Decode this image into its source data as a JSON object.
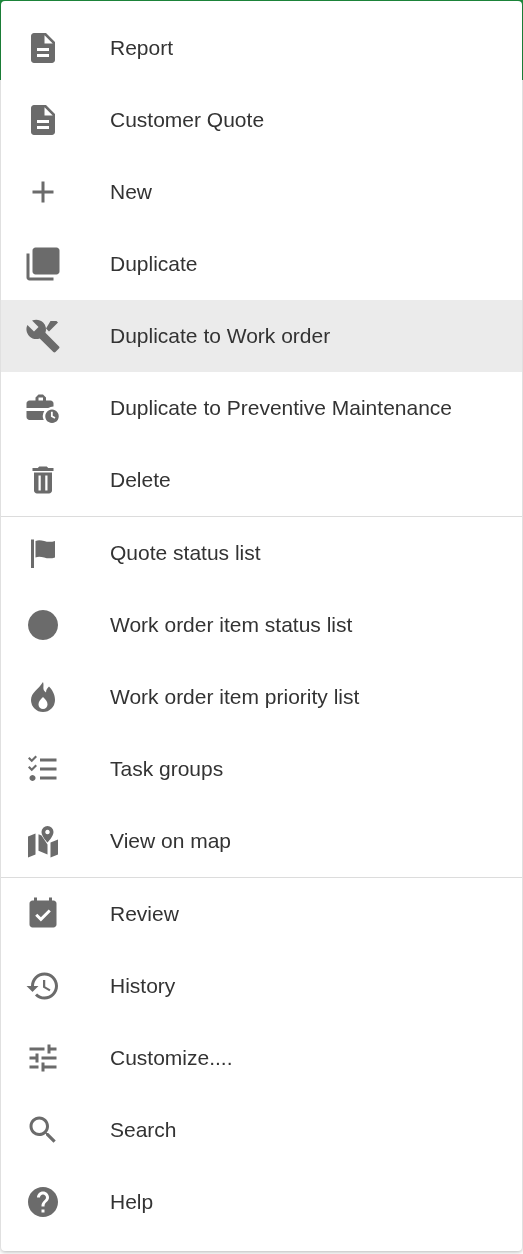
{
  "menu": {
    "groups": [
      {
        "items": [
          {
            "label": "Report",
            "kind": "document",
            "selected": false
          },
          {
            "label": "Customer Quote",
            "kind": "document",
            "selected": false
          },
          {
            "label": "New",
            "kind": "plus",
            "selected": false
          },
          {
            "label": "Duplicate",
            "kind": "copy",
            "selected": false
          },
          {
            "label": "Duplicate to Work order",
            "kind": "tools",
            "selected": true
          },
          {
            "label": "Duplicate to Preventive Maintenance",
            "kind": "briefcase",
            "selected": false
          },
          {
            "label": "Delete",
            "kind": "trash",
            "selected": false
          }
        ]
      },
      {
        "items": [
          {
            "label": "Quote status list",
            "kind": "flag",
            "selected": false
          },
          {
            "label": "Work order item status list",
            "kind": "circle",
            "selected": false
          },
          {
            "label": "Work order item priority list",
            "kind": "flame",
            "selected": false
          },
          {
            "label": "Task groups",
            "kind": "checklist",
            "selected": false
          },
          {
            "label": "View on map",
            "kind": "map",
            "selected": false
          }
        ]
      },
      {
        "items": [
          {
            "label": "Review",
            "kind": "calendar",
            "selected": false
          },
          {
            "label": "History",
            "kind": "history",
            "selected": false
          },
          {
            "label": "Customize....",
            "kind": "sliders",
            "selected": false
          },
          {
            "label": "Search",
            "kind": "search",
            "selected": false
          },
          {
            "label": "Help",
            "kind": "help",
            "selected": false
          }
        ]
      }
    ]
  }
}
